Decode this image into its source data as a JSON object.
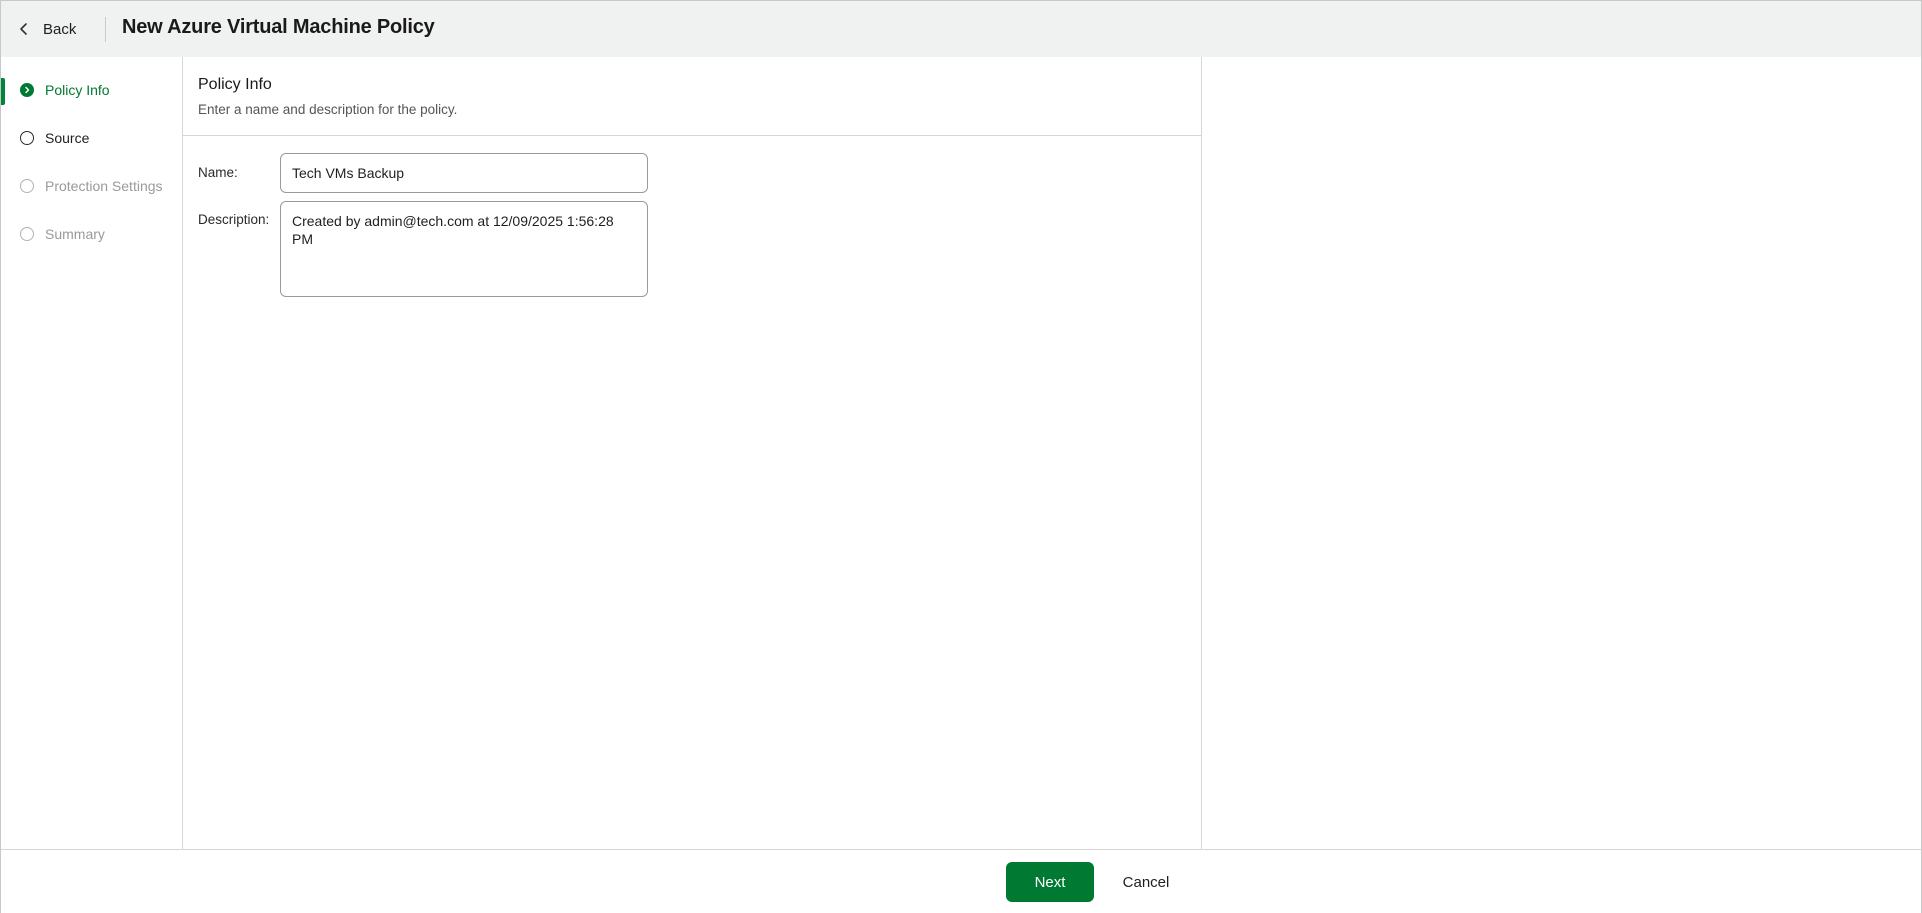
{
  "header": {
    "back_label": "Back",
    "title": "New Azure Virtual Machine Policy"
  },
  "wizard": {
    "steps": [
      {
        "label": "Policy Info",
        "state": "active"
      },
      {
        "label": "Source",
        "state": "next"
      },
      {
        "label": "Protection Settings",
        "state": "disabled"
      },
      {
        "label": "Summary",
        "state": "disabled"
      }
    ]
  },
  "form": {
    "section_title": "Policy Info",
    "section_description": "Enter a name and description for the policy.",
    "name_label": "Name:",
    "name_value": "Tech VMs Backup",
    "description_label": "Description:",
    "description_value": "Created by admin@tech.com at 12/09/2025 1:56:28 PM"
  },
  "footer": {
    "next_label": "Next",
    "cancel_label": "Cancel"
  },
  "colors": {
    "accent": "#007a33",
    "header_bg": "#f0f1f1"
  },
  "icons": {
    "back": "chevron-left-icon",
    "active_step": "chevron-right-circle-icon"
  }
}
